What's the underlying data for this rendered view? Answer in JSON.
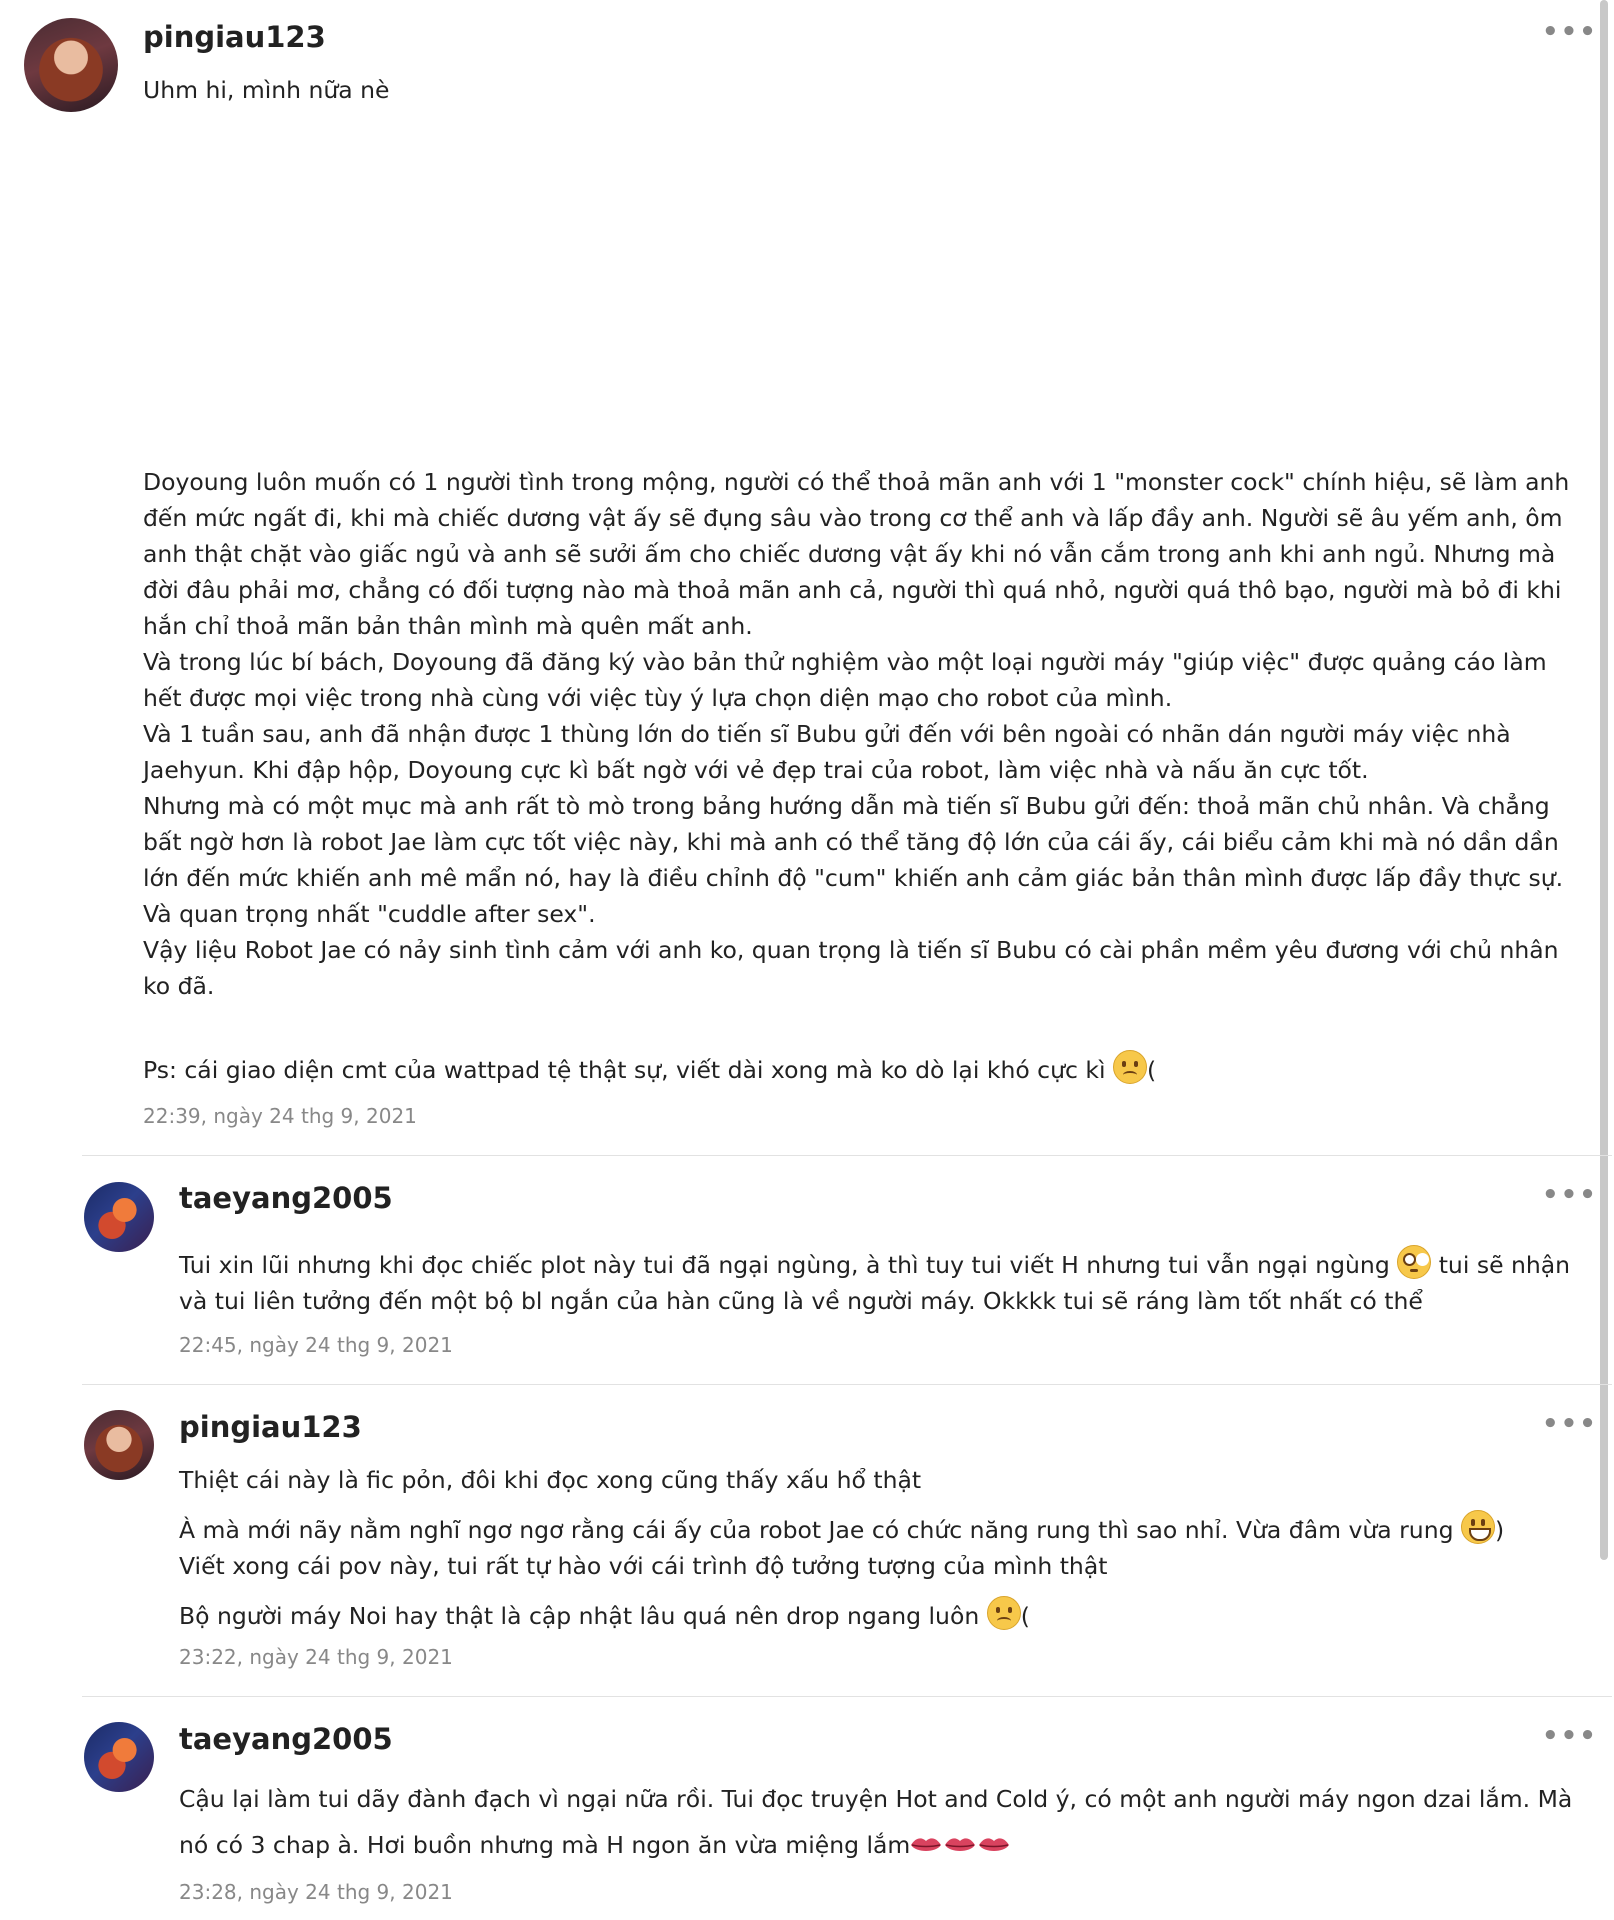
{
  "comments": [
    {
      "username": "pingiau123",
      "paragraphs": [
        "Uhm hi, mình nữa nè",
        "Doyoung luôn muốn có 1 người tình trong mộng, người có thể thoả mãn anh với 1 \"monster cock\" chính hiệu, sẽ làm anh đến mức ngất đi, khi mà chiếc dương vật ấy sẽ đụng sâu vào trong cơ thể anh và lấp đầy anh. Người sẽ âu yếm anh, ôm anh thật chặt vào giấc ngủ và anh sẽ sưởi ấm cho chiếc dương vật ấy khi nó vẫn cắm trong anh khi anh ngủ. Nhưng mà đời đâu phải mơ, chẳng có đối tượng nào mà thoả mãn anh cả, người thì quá nhỏ, người quá thô bạo, người mà bỏ đi khi hắn chỉ thoả mãn bản thân mình mà quên mất anh.",
        "Và trong lúc bí bách, Doyoung đã đăng ký vào bản thử nghiệm vào một loại người máy \"giúp việc\" được quảng cáo làm hết được mọi việc trong nhà cùng với việc tùy ý lựa chọn diện mạo cho robot của mình.",
        "Và 1 tuần sau, anh đã nhận được 1 thùng lớn do tiến sĩ Bubu gửi đến với bên ngoài có nhãn dán người máy việc nhà Jaehyun. Khi đập hộp, Doyoung cực kì bất ngờ với vẻ đẹp trai của robot, làm việc nhà và nấu ăn cực tốt.",
        "Nhưng mà có một mục mà anh rất tò mò trong bảng hướng dẫn mà tiến sĩ Bubu gửi đến: thoả mãn chủ nhân. Và chẳng bất ngờ hơn là robot Jae làm cực tốt việc này, khi mà anh có thể tăng độ lớn của cái ấy, cái biểu cảm khi mà nó dần dần lớn đến mức khiến anh mê mẩn nó, hay là điều chỉnh độ \"cum\" khiến anh cảm giác bản thân mình được lấp đầy thực sự. Và quan trọng nhất \"cuddle after sex\".",
        "Vậy liệu Robot Jae có nảy sinh tình cảm với anh ko, quan trọng là tiến sĩ Bubu có cài phần mềm yêu đương với chủ nhân ko đã.",
        "Ps: cái giao diện cmt của wattpad tệ thật sự, viết dài xong mà ko dò lại khó cực kì",
        "("
      ],
      "timestamp": "22:39, ngày 24 thg 9, 2021"
    },
    {
      "username": "taeyang2005",
      "paragraphs": [
        "Tui xin lũi nhưng khi đọc chiếc plot này tui đã ngại ngùng, à thì tuy tui viết H nhưng tui vẫn ngại ngùng",
        "tui sẽ nhận và tui liên tưởng đến một bộ bl ngắn của hàn cũng là về người máy. Okkkk tui sẽ ráng làm tốt nhất có thể"
      ],
      "timestamp": "22:45, ngày 24 thg 9, 2021"
    },
    {
      "username": "pingiau123",
      "paragraphs": [
        "Thiệt cái này là fic pỏn, đôi khi đọc xong cũng thấy xấu hổ thật",
        "À mà mới nãy nằm nghĩ ngơ ngơ rằng cái ấy của robot Jae có chức năng rung thì sao nhỉ. Vừa đâm vừa rung",
        ")",
        "Viết xong cái pov này, tui rất tự hào với cái trình độ tưởng tượng của mình thật",
        "Bộ người máy Noi hay thật là cập nhật lâu quá nên drop ngang luôn",
        "("
      ],
      "timestamp": "23:22, ngày 24 thg 9, 2021"
    },
    {
      "username": "taeyang2005",
      "paragraphs": [
        "Cậu lại làm tui dãy đành đạch vì ngại nữa rồi. Tui đọc truyện Hot and Cold ý, có một anh người máy ngon dzai lắm. Mà nó có 3 chap à. Hơi buồn nhưng mà H ngon ăn vừa miệng lắm"
      ],
      "timestamp": "23:28, ngày 24 thg 9, 2021"
    }
  ],
  "more_label": "•••"
}
